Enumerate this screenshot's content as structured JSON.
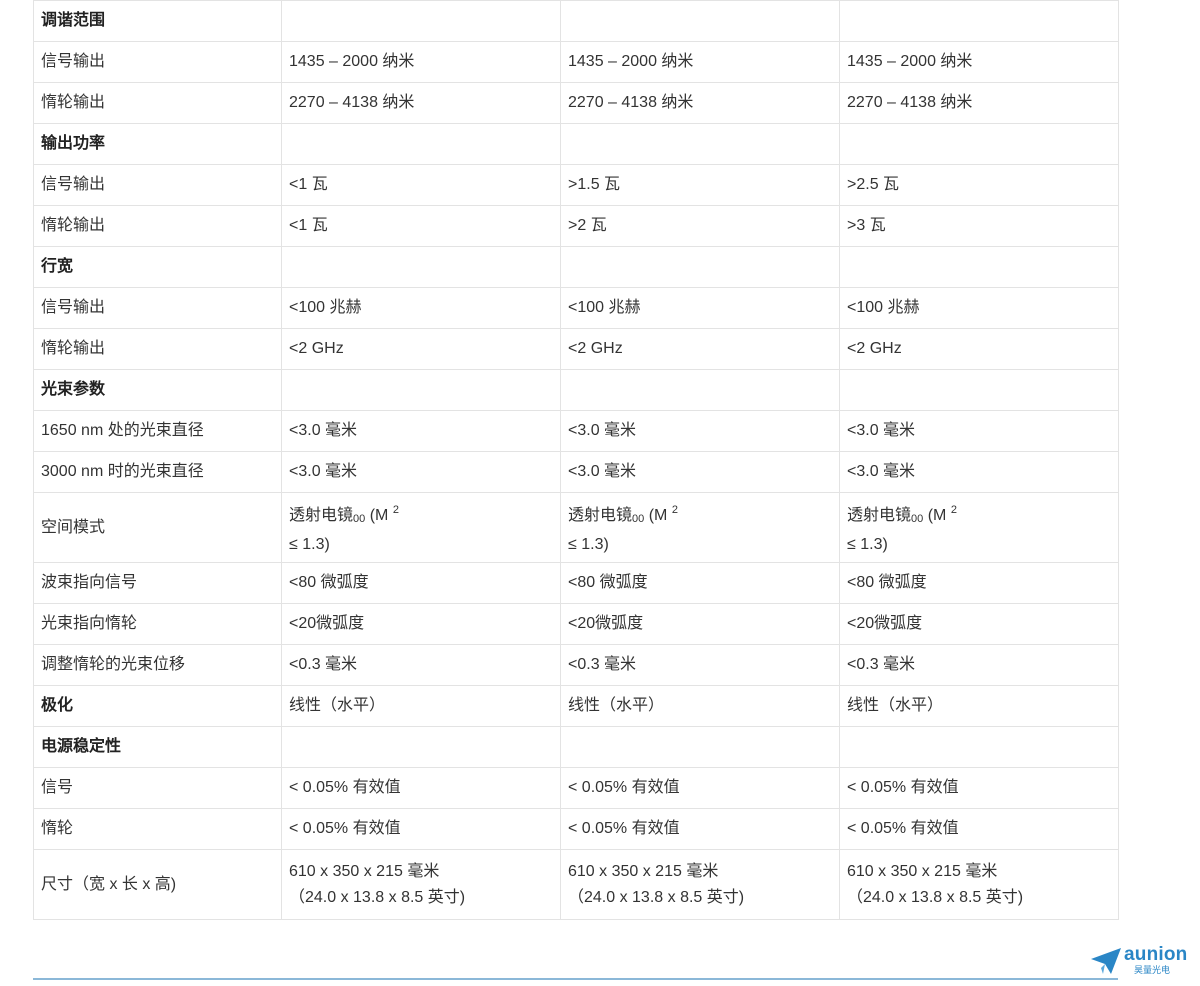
{
  "rows": [
    {
      "label": "调谐范围",
      "section": true,
      "v": [
        "",
        "",
        ""
      ]
    },
    {
      "label": "信号输出",
      "v": [
        "1435 – 2000 纳米",
        "1435 – 2000 纳米",
        "1435 – 2000 纳米"
      ]
    },
    {
      "label": "惰轮输出",
      "v": [
        "2270 – 4138 纳米",
        "2270 – 4138 纳米",
        "2270 – 4138 纳米"
      ]
    },
    {
      "label": "输出功率",
      "section": true,
      "v": [
        "",
        "",
        ""
      ]
    },
    {
      "label": "信号输出",
      "v": [
        "<1 瓦",
        ">1.5 瓦",
        ">2.5 瓦"
      ]
    },
    {
      "label": "惰轮输出",
      "v": [
        "<1 瓦",
        ">2 瓦",
        ">3 瓦"
      ]
    },
    {
      "label": "行宽",
      "section": true,
      "v": [
        "",
        "",
        ""
      ]
    },
    {
      "label": "信号输出",
      "v": [
        "<100 兆赫",
        "<100 兆赫",
        "<100 兆赫"
      ]
    },
    {
      "label": "惰轮输出",
      "v": [
        "<2 GHz",
        "<2 GHz",
        "<2 GHz"
      ]
    },
    {
      "label": "光束参数",
      "section": true,
      "v": [
        "",
        "",
        ""
      ]
    },
    {
      "label": "1650 nm 处的光束直径",
      "v": [
        "<3.0 毫米",
        "<3.0 毫米",
        "<3.0 毫米"
      ]
    },
    {
      "label": "3000 nm 时的光束直径",
      "v": [
        "<3.0 毫米",
        "<3.0 毫米",
        "<3.0 毫米"
      ]
    },
    {
      "label": "空间模式",
      "mode": {
        "main": "透射电镜",
        "sub": "00",
        "rest": " (M ",
        "sup": "2",
        "line2": "≤ 1.3)"
      }
    },
    {
      "label": "波束指向信号",
      "v": [
        "<80 微弧度",
        "<80 微弧度",
        "<80 微弧度"
      ]
    },
    {
      "label": "光束指向惰轮",
      "v": [
        "<20微弧度",
        "<20微弧度",
        "<20微弧度"
      ]
    },
    {
      "label": "调整惰轮的光束位移",
      "v": [
        "<0.3 毫米",
        "<0.3 毫米",
        "<0.3 毫米"
      ]
    },
    {
      "label": "极化",
      "bold": true,
      "v": [
        "线性（水平）",
        "线性（水平）",
        "线性（水平）"
      ]
    },
    {
      "label": "电源稳定性",
      "section": true,
      "v": [
        "",
        "",
        ""
      ]
    },
    {
      "label": "信号",
      "v": [
        "< 0.05% 有效值",
        "< 0.05% 有效值",
        "< 0.05% 有效值"
      ]
    },
    {
      "label": "惰轮",
      "v": [
        "< 0.05% 有效值",
        "< 0.05% 有效值",
        "< 0.05% 有效值"
      ]
    },
    {
      "label": "尺寸（宽 x 长 x 高)",
      "dims": {
        "line1": "610 x 350 x 215 毫米",
        "line2": "（24.0 x 13.8 x 8.5 英寸)"
      }
    }
  ],
  "logo": {
    "name": "aunion",
    "subtitle": "昊量光电",
    "color": "#2a86c6"
  },
  "divider_color": "#8bb8d8"
}
